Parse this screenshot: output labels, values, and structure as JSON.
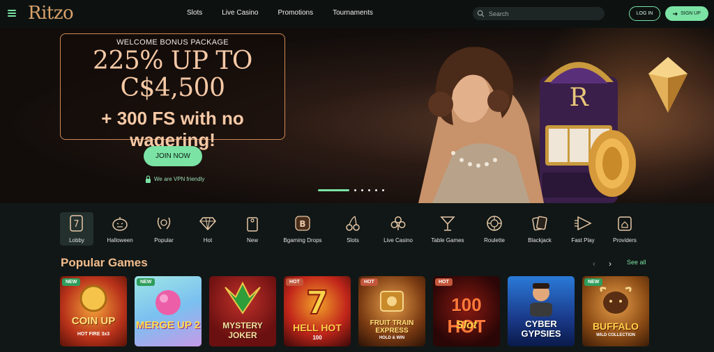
{
  "header": {
    "logo": "Ritzo",
    "nav": [
      "Slots",
      "Live Casino",
      "Promotions",
      "Tournaments"
    ],
    "search_placeholder": "Search",
    "login_label": "LOG IN",
    "signup_label": "SIGN UP",
    "accent_color": "#7be3a4"
  },
  "hero": {
    "label": "WELCOME BONUS PACKAGE",
    "line1": "225% UP TO",
    "line2": "C$4,500",
    "line3": "+ 300 FS with no wagering!",
    "cta": "JOIN NOW",
    "vpn_text": "We are VPN friendly",
    "slot_letter": "R",
    "slides_total": 6,
    "slide_active": 1
  },
  "categories": [
    {
      "label": "Lobby",
      "icon": "lucky-seven-icon",
      "active": true
    },
    {
      "label": "Halloween",
      "icon": "pumpkin-icon",
      "active": false
    },
    {
      "label": "Popular",
      "icon": "laurel-icon",
      "active": false
    },
    {
      "label": "Hot",
      "icon": "diamond-icon",
      "active": false
    },
    {
      "label": "New",
      "icon": "door-tag-icon",
      "active": false
    },
    {
      "label": "Bgaming Drops",
      "icon": "b-badge-icon",
      "active": false
    },
    {
      "label": "Slots",
      "icon": "cherries-icon",
      "active": false
    },
    {
      "label": "Live Casino",
      "icon": "clubs-icon",
      "active": false
    },
    {
      "label": "Table Games",
      "icon": "cocktail-icon",
      "active": false
    },
    {
      "label": "Roulette",
      "icon": "roulette-icon",
      "active": false
    },
    {
      "label": "Blackjack",
      "icon": "cards-icon",
      "active": false
    },
    {
      "label": "Fast Play",
      "icon": "fast-play-icon",
      "active": false
    },
    {
      "label": "Providers",
      "icon": "providers-icon",
      "active": false
    }
  ],
  "popular": {
    "title": "Popular Games",
    "see_all": "See all",
    "games": [
      {
        "badge": "NEW",
        "title": "COIN UP",
        "subtitle": "HOT FIRE 3x3"
      },
      {
        "badge": "NEW",
        "title": "MERGE UP 2",
        "subtitle": ""
      },
      {
        "badge": "",
        "title": "MYSTERY JOKER",
        "subtitle": ""
      },
      {
        "badge": "HOT",
        "title": "HELL HOT",
        "subtitle": "100"
      },
      {
        "badge": "HOT",
        "title": "FRUIT TRAIN EXPRESS",
        "subtitle": "HOLD & WIN"
      },
      {
        "badge": "HOT",
        "title": "100 HOT",
        "subtitle": "Slot"
      },
      {
        "badge": "",
        "title": "CYBER GYPSIES",
        "subtitle": ""
      },
      {
        "badge": "NEW",
        "title": "BUFFALO",
        "subtitle": "WILD COLLECTION"
      }
    ]
  }
}
